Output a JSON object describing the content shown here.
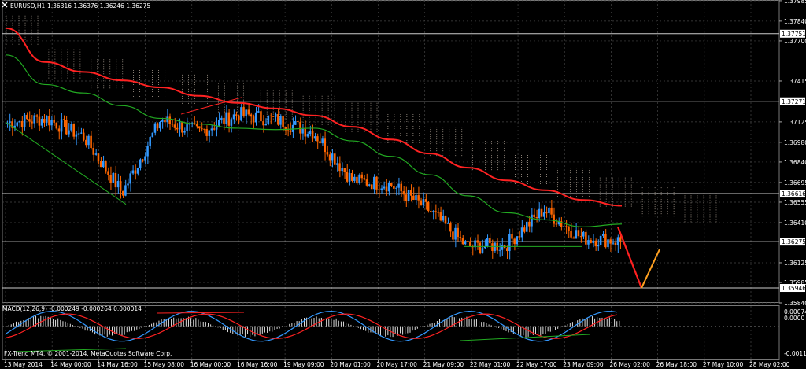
{
  "header": {
    "symbol": "EURUSD,H1",
    "ohlc": "1.36316 1.36376 1.36246 1.36275"
  },
  "macd": {
    "label": "MACD(12,26,9) -0.000249 -0.000264 0.000014",
    "axis": [
      "0.00074",
      "0.0000",
      "-0.00119"
    ]
  },
  "watermark": "FX-Trend MT4, © 2001-2014, MetaQuotes Software Corp.",
  "price_axis": {
    "ticks": [
      "1.37985",
      "1.37840",
      "1.37700",
      "1.37415",
      "1.37125",
      "1.36980",
      "1.36840",
      "1.36695",
      "1.36555",
      "1.36410",
      "1.36125",
      "1.35985",
      "1.35840"
    ],
    "hlines": [
      "1.37751",
      "1.37271",
      "1.36616",
      "1.36275",
      "1.35946"
    ]
  },
  "time_axis": [
    "13 May 2014",
    "14 May 00:00",
    "14 May 16:00",
    "15 May 08:00",
    "16 May 00:00",
    "16 May 16:00",
    "19 May 09:00",
    "20 May 01:00",
    "20 May 17:00",
    "21 May 09:00",
    "22 May 01:00",
    "22 May 17:00",
    "23 May 09:00",
    "26 May 02:00",
    "26 May 18:00",
    "27 May 10:00",
    "28 May 02:00"
  ],
  "colors": {
    "background": "#000000",
    "grid": "#444444",
    "bull_candle": "#3399ff",
    "bear_candle": "#ff6600",
    "ma_slow": "#ff2222",
    "ma_fast": "#22aa22",
    "cloud": "#d8c8b8",
    "forecast_down": "#ff2020",
    "forecast_up": "#ffa020",
    "macd_main": "#3399ff",
    "macd_signal": "#ff2222"
  },
  "chart_data": {
    "type": "candlestick",
    "symbol": "EURUSD,H1",
    "ylim": [
      1.3584,
      1.3799
    ],
    "x": [
      "13 May 2014",
      "14 May 00:00",
      "14 May 16:00",
      "15 May 08:00",
      "16 May 00:00",
      "16 May 16:00",
      "19 May 09:00",
      "20 May 01:00",
      "20 May 17:00",
      "21 May 09:00",
      "22 May 01:00",
      "22 May 17:00",
      "23 May 09:00",
      "26 May 02:00",
      "26 May 18:00",
      "27 May 10:00",
      "28 May 02:00"
    ],
    "close": [
      1.3712,
      1.3715,
      1.3702,
      1.3662,
      1.3714,
      1.3705,
      1.3718,
      1.3714,
      1.3705,
      1.3671,
      1.3668,
      1.365,
      1.3624,
      1.3625,
      1.365,
      1.363,
      1.3628
    ],
    "ma_slow": [
      1.3779,
      1.3755,
      1.3748,
      1.3742,
      1.3737,
      1.3731,
      1.3726,
      1.3722,
      1.3717,
      1.3709,
      1.37,
      1.369,
      1.368,
      1.3671,
      1.3664,
      1.3657,
      1.3653
    ],
    "ma_fast": [
      1.376,
      1.3739,
      1.3733,
      1.3724,
      1.3715,
      1.3711,
      1.3708,
      1.3707,
      1.3708,
      1.3699,
      1.3688,
      1.3675,
      1.366,
      1.3648,
      1.3643,
      1.3638,
      1.364
    ],
    "forecast": {
      "from": 1.3638,
      "low": 1.35946,
      "rebound": 1.3622
    },
    "macd_range": [
      -0.00119,
      0.00074
    ]
  }
}
